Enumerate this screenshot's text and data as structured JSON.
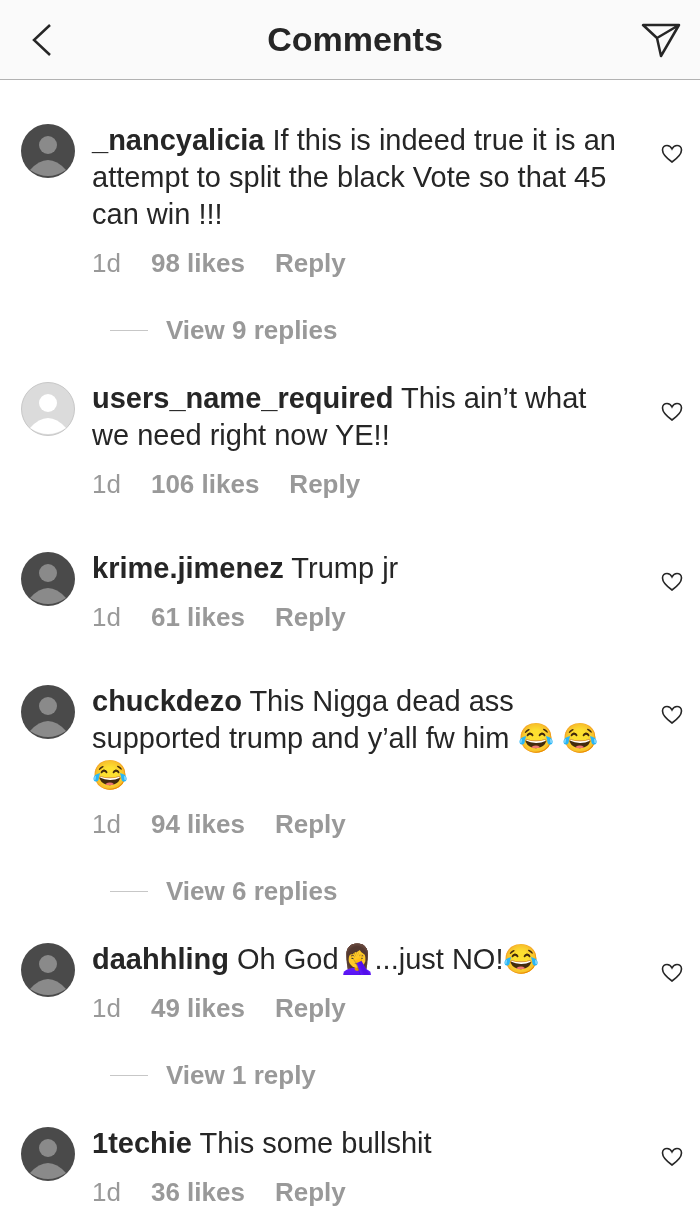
{
  "header": {
    "title": "Comments"
  },
  "comments": [
    {
      "kind": "photo",
      "user": "_nancyalicia",
      "text": "If this is indeed true it is an attempt to split the black Vote so that 45 can win !!!",
      "time": "1d",
      "likes": "98 likes",
      "reply": "Reply",
      "replies": "View 9 replies",
      "liked": false
    },
    {
      "kind": "default",
      "user": "users_name_required",
      "text": "This ain’t what we need right now YE!!",
      "time": "1d",
      "likes": "106 likes",
      "reply": "Reply",
      "liked": false
    },
    {
      "kind": "photo",
      "user": "krime.jimenez",
      "text": "Trump jr",
      "time": "1d",
      "likes": "61 likes",
      "reply": "Reply",
      "liked": false
    },
    {
      "kind": "photo",
      "user": "chuckdezo",
      "text": "This Nigga dead ass supported trump and y’all fw him 😂 😂 😂",
      "time": "1d",
      "likes": "94 likes",
      "reply": "Reply",
      "replies": "View 6 replies",
      "liked": false
    },
    {
      "kind": "photo",
      "user": "daahhling",
      "text": "Oh God🤦‍♀️...just NO!😂",
      "time": "1d",
      "likes": "49 likes",
      "reply": "Reply",
      "replies": "View 1 reply",
      "liked": false
    },
    {
      "kind": "photo",
      "user": "1techie",
      "text": "This some bullshit",
      "time": "1d",
      "likes": "36 likes",
      "reply": "Reply",
      "liked": false
    }
  ]
}
